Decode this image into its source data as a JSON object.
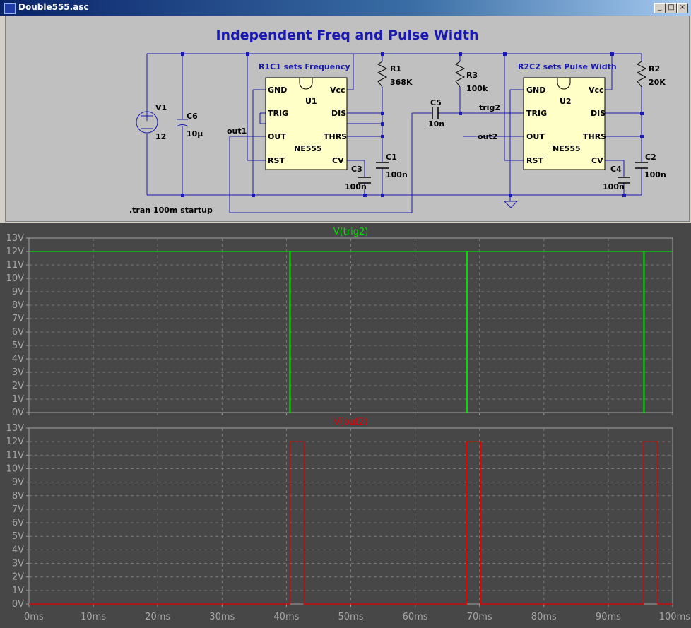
{
  "window": {
    "title": "Double555.asc",
    "minimize": "_",
    "maximize": "□",
    "close": "×"
  },
  "schematic": {
    "title": "Independent Freq and Pulse Width",
    "block1_label": "R1C1 sets Frequency",
    "block2_label": "R2C2 sets Pulse Width",
    "directive": ".tran 100m startup",
    "components": {
      "V1": {
        "name": "V1",
        "value": "12"
      },
      "C6": {
        "name": "C6",
        "value": "10µ"
      },
      "R1": {
        "name": "R1",
        "value": "368K"
      },
      "R3": {
        "name": "R3",
        "value": "100k"
      },
      "R2": {
        "name": "R2",
        "value": "20K"
      },
      "C5": {
        "name": "C5",
        "value": "10n"
      },
      "C1": {
        "name": "C1",
        "value": "100n"
      },
      "C3": {
        "name": "C3",
        "value": "100n"
      },
      "C2": {
        "name": "C2",
        "value": "100n"
      },
      "C4": {
        "name": "C4",
        "value": "100n"
      }
    },
    "chips": [
      {
        "name": "U1",
        "part": "NE555",
        "pins": {
          "gnd": "GND",
          "vcc": "Vcc",
          "trig": "TRIG",
          "dis": "DIS",
          "out": "OUT",
          "thrs": "THRS",
          "rst": "RST",
          "cv": "CV"
        }
      },
      {
        "name": "U2",
        "part": "NE555",
        "pins": {
          "gnd": "GND",
          "vcc": "Vcc",
          "trig": "TRIG",
          "dis": "DIS",
          "out": "OUT",
          "thrs": "THRS",
          "rst": "RST",
          "cv": "CV"
        }
      }
    ],
    "nets": {
      "out1": "out1",
      "trig2": "trig2",
      "out2": "out2"
    }
  },
  "colors": {
    "wire": "#1a1ab0",
    "chip_fill": "#ffffc8",
    "plot_bg": "#474747",
    "grid": "#808080",
    "trace1": "#00e000",
    "trace2": "#e00000"
  },
  "chart_data": [
    {
      "type": "line",
      "title": "V(trig2)",
      "color": "#00e000",
      "x_ticks": [
        "0ms",
        "10ms",
        "20ms",
        "30ms",
        "40ms",
        "50ms",
        "60ms",
        "70ms",
        "80ms",
        "90ms",
        "100ms"
      ],
      "y_ticks": [
        "0V",
        "1V",
        "2V",
        "3V",
        "4V",
        "5V",
        "6V",
        "7V",
        "8V",
        "9V",
        "10V",
        "11V",
        "12V",
        "13V"
      ],
      "xlim": [
        0,
        100
      ],
      "ylim": [
        0,
        13
      ],
      "x_unit": "ms",
      "series": [
        {
          "name": "V(trig2)",
          "x": [
            0,
            40.5,
            40.5,
            40.6,
            40.6,
            68.0,
            68.0,
            68.1,
            68.1,
            95.5,
            95.5,
            95.6,
            95.6,
            100
          ],
          "y": [
            12,
            12,
            0,
            0,
            12,
            12,
            0,
            0,
            12,
            12,
            0,
            0,
            12,
            12
          ]
        }
      ],
      "grid": true
    },
    {
      "type": "line",
      "title": "V(out2)",
      "color": "#e00000",
      "x_ticks": [
        "0ms",
        "10ms",
        "20ms",
        "30ms",
        "40ms",
        "50ms",
        "60ms",
        "70ms",
        "80ms",
        "90ms",
        "100ms"
      ],
      "y_ticks": [
        "0V",
        "1V",
        "2V",
        "3V",
        "4V",
        "5V",
        "6V",
        "7V",
        "8V",
        "9V",
        "10V",
        "11V",
        "12V",
        "13V"
      ],
      "xlim": [
        0,
        100
      ],
      "ylim": [
        0,
        13
      ],
      "x_unit": "ms",
      "series": [
        {
          "name": "V(out2)",
          "x": [
            0,
            40.5,
            40.5,
            42.7,
            42.7,
            68.0,
            68.0,
            70.2,
            70.2,
            95.5,
            95.5,
            97.7,
            97.7,
            100
          ],
          "y": [
            0,
            0,
            12,
            12,
            0,
            0,
            12,
            12,
            0,
            0,
            12,
            12,
            0,
            0
          ]
        }
      ],
      "grid": true
    }
  ]
}
